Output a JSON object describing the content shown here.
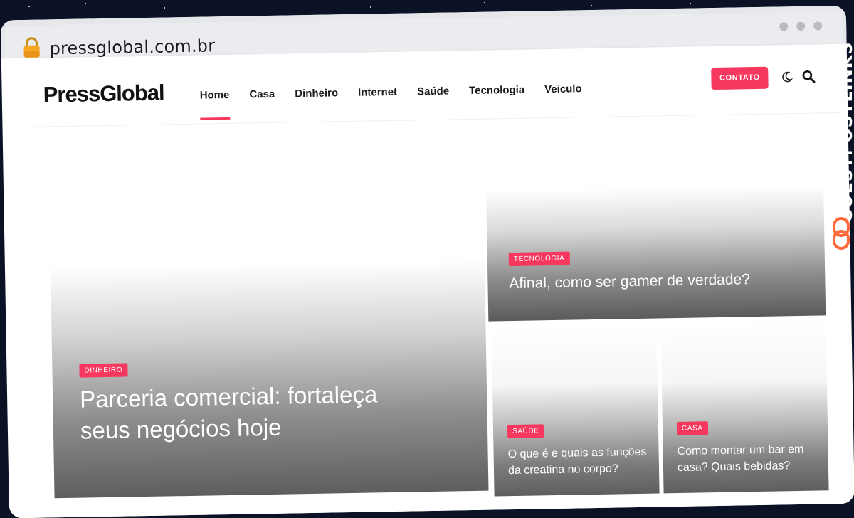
{
  "browser": {
    "url": "pressglobal.com.br"
  },
  "site": {
    "logo": "PressGlobal",
    "nav": [
      "Home",
      "Casa",
      "Dinheiro",
      "Internet",
      "Saúde",
      "Tecnologia",
      "Veiculo"
    ],
    "active_nav": "Home",
    "contact_label": "CONTATO"
  },
  "featured": {
    "main": {
      "tag": "DINHEIRO",
      "title": "Parceria comercial: fortaleça seus negócios hoje"
    },
    "top": {
      "tag": "TECNOLOGIA",
      "title": "Afinal, como ser gamer de verdade?"
    },
    "bottom_left": {
      "tag": "SAÚDE",
      "title": "O que é e quais as funções da creatina no corpo?"
    },
    "bottom_right": {
      "tag": "CASA",
      "title": "Como montar um bar em casa? Quais bebidas?"
    }
  },
  "watermark": {
    "text": "GUESTPOSTLINKS"
  },
  "colors": {
    "accent": "#f7385e",
    "background": "#0b1226",
    "watermark_icon": "#ff6a3d"
  },
  "icons": [
    "lock-icon",
    "moon-icon",
    "search-icon",
    "link-icon"
  ]
}
